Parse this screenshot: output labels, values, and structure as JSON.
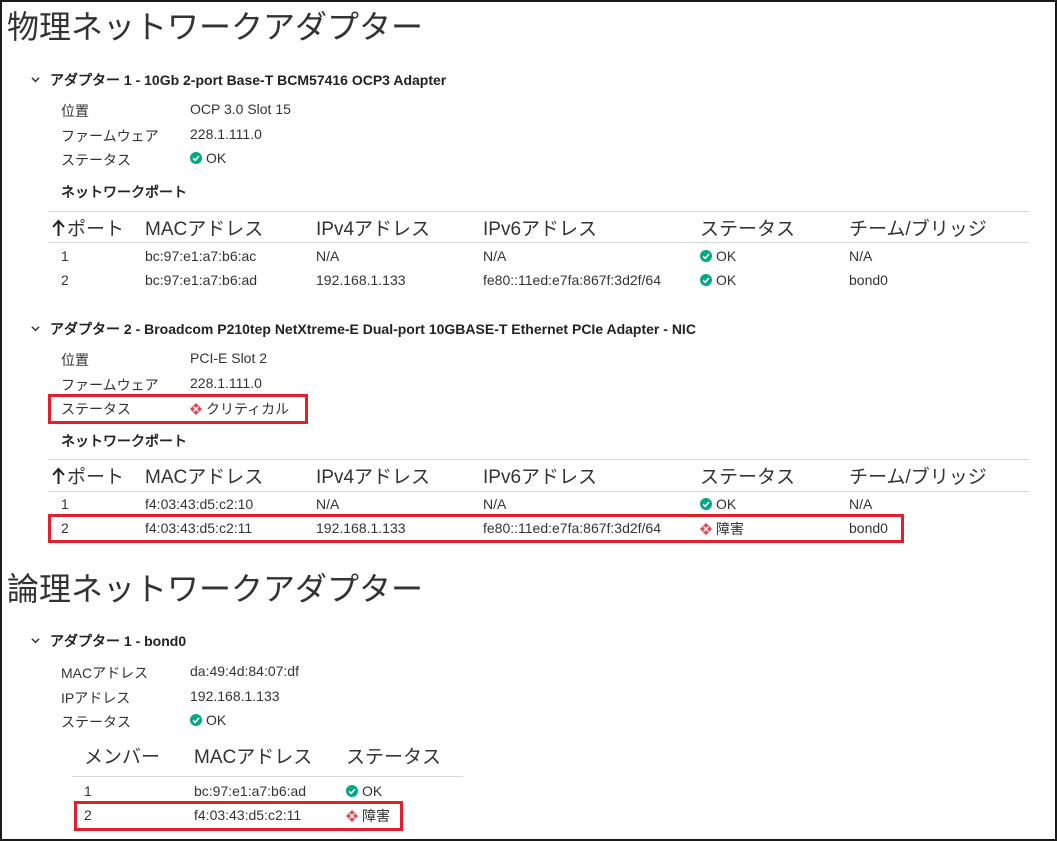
{
  "physical": {
    "title": "物理ネットワークアダプター",
    "adapters": [
      {
        "header": "アダプター 1 - 10Gb 2-port Base-T BCM57416 OCP3 Adapter",
        "location_label": "位置",
        "location": "OCP 3.0 Slot 15",
        "firmware_label": "ファームウェア",
        "firmware": "228.1.111.0",
        "status_label": "ステータス",
        "status": "OK",
        "ports_title": "ネットワークポート",
        "columns": [
          "ポート",
          "MACアドレス",
          "IPv4アドレス",
          "IPv6アドレス",
          "ステータス",
          "チーム/ブリッジ"
        ],
        "rows": [
          [
            "1",
            "bc:97:e1:a7:b6:ac",
            "N/A",
            "N/A",
            "OK",
            "N/A"
          ],
          [
            "2",
            "bc:97:e1:a7:b6:ad",
            "192.168.1.133",
            "fe80::11ed:e7fa:867f:3d2f/64",
            "OK",
            "bond0"
          ]
        ]
      },
      {
        "header": "アダプター 2 - Broadcom P210tep NetXtreme-E Dual-port 10GBASE-T Ethernet PCIe Adapter - NIC",
        "location_label": "位置",
        "location": "PCI-E Slot 2",
        "firmware_label": "ファームウェア",
        "firmware": "228.1.111.0",
        "status_label": "ステータス",
        "status": "クリティカル",
        "ports_title": "ネットワークポート",
        "columns": [
          "ポート",
          "MACアドレス",
          "IPv4アドレス",
          "IPv6アドレス",
          "ステータス",
          "チーム/ブリッジ"
        ],
        "rows": [
          [
            "1",
            "f4:03:43:d5:c2:10",
            "N/A",
            "N/A",
            "OK",
            "N/A"
          ],
          [
            "2",
            "f4:03:43:d5:c2:11",
            "192.168.1.133",
            "fe80::11ed:e7fa:867f:3d2f/64",
            "障害",
            "bond0"
          ]
        ]
      }
    ]
  },
  "logical": {
    "title": "論理ネットワークアダプター",
    "adapter": {
      "header": "アダプター 1 - bond0",
      "mac_label": "MACアドレス",
      "mac": "da:49:4d:84:07:df",
      "ip_label": "IPアドレス",
      "ip": "192.168.1.133",
      "status_label": "ステータス",
      "status": "OK",
      "columns": [
        "メンバー",
        "MACアドレス",
        "ステータス"
      ],
      "rows": [
        [
          "1",
          "bc:97:e1:a7:b6:ad",
          "OK"
        ],
        [
          "2",
          "f4:03:43:d5:c2:11",
          "障害"
        ]
      ]
    }
  },
  "colors": {
    "ok": "#01a982",
    "critical": "#e5434f",
    "highlight": "#e0202b"
  },
  "icons": {
    "ok": "check-circle-icon",
    "critical": "critical-diamond-icon",
    "expand": "chevron-down-icon",
    "sort": "arrow-up-icon"
  }
}
